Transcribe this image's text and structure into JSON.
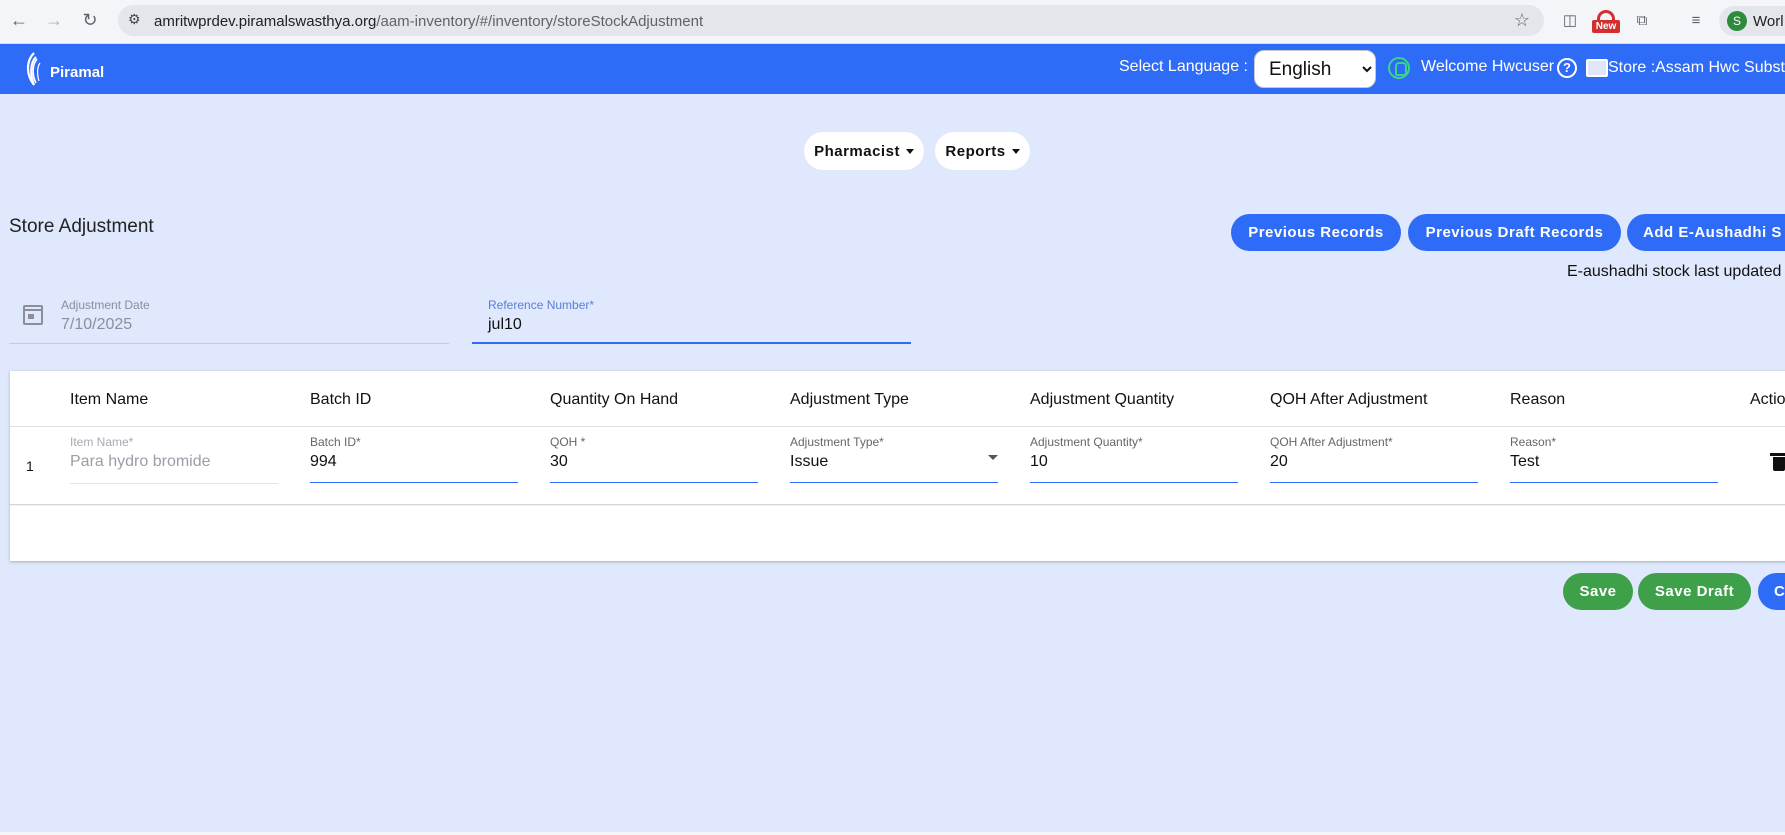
{
  "browser": {
    "url_host": "amritwprdev.piramalswasthya.org",
    "url_path": "/aam-inventory/#/inventory/storeStockAdjustment",
    "badge_new": "New",
    "profile_initial": "S",
    "profile_name": "Worl"
  },
  "header": {
    "brand": "Piramal",
    "language_label": "Select Language :",
    "language_selected": "English",
    "language_options": [
      "English"
    ],
    "welcome_prefix": "Welcome",
    "username": "Hwcuser",
    "store_label": "Store :Assam Hwc Substo"
  },
  "menus": {
    "pharmacist": "Pharmacist",
    "reports": "Reports"
  },
  "page": {
    "title": "Store Adjustment",
    "actions": {
      "previous_records": "Previous Records",
      "previous_draft_records": "Previous Draft Records",
      "add_eaushadhi": "Add E-Aushadhi S"
    },
    "eaushadhi_note": "E-aushadhi stock last updated o"
  },
  "form": {
    "adjustment_date_label": "Adjustment Date",
    "adjustment_date_value": "7/10/2025",
    "reference_label": "Reference Number*",
    "reference_value": "jul10"
  },
  "table": {
    "headers": [
      "Item Name",
      "Batch ID",
      "Quantity On Hand",
      "Adjustment Type",
      "Adjustment Quantity",
      "QOH After Adjustment",
      "Reason",
      "Actio"
    ],
    "rows": [
      {
        "index": "1",
        "item_name_label": "Item Name*",
        "item_name": "Para hydro bromide",
        "batch_label": "Batch ID*",
        "batch": "994",
        "qoh_label": "QOH *",
        "qoh": "30",
        "adj_type_label": "Adjustment Type*",
        "adj_type": "Issue",
        "adj_qty_label": "Adjustment Quantity*",
        "adj_qty": "10",
        "qoh_after_label": "QOH After Adjustment*",
        "qoh_after": "20",
        "reason_label": "Reason*",
        "reason": "Test"
      }
    ]
  },
  "footer_actions": {
    "save": "Save",
    "save_draft": "Save Draft",
    "cut_button": "C"
  },
  "colors": {
    "primary": "#2e6bf6",
    "success": "#3fa04a",
    "page_bg": "#dfe8fc"
  }
}
